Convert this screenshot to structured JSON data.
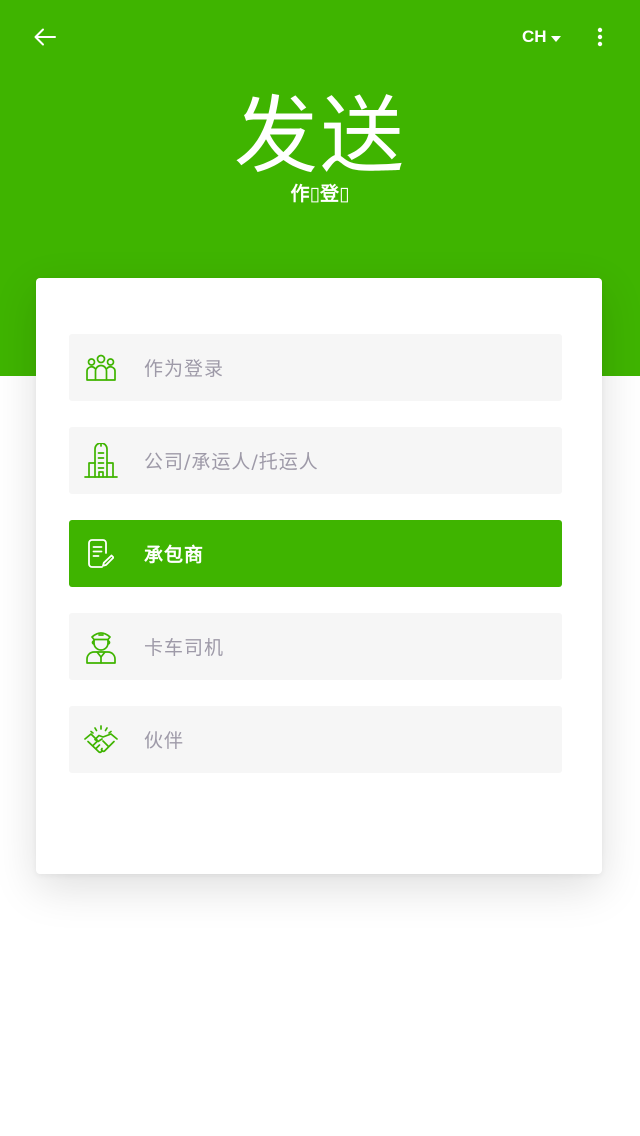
{
  "header": {
    "language": "CH",
    "title": "发送",
    "subtitle": "作▯登▯"
  },
  "colors": {
    "brand": "#3fb400",
    "option_bg": "#f6f6f6",
    "option_text": "#9e9aa8"
  },
  "icons": {
    "back": "arrow-left-icon",
    "language": "caret-down-icon",
    "more": "more-vertical-icon"
  },
  "roles": [
    {
      "label": "作为登录",
      "icon": "group-icon",
      "selected": false
    },
    {
      "label": "公司/承运人/托运人",
      "icon": "building-icon",
      "selected": false
    },
    {
      "label": "承包商",
      "icon": "contract-edit-icon",
      "selected": true
    },
    {
      "label": "卡车司机",
      "icon": "driver-icon",
      "selected": false
    },
    {
      "label": "伙伴",
      "icon": "handshake-icon",
      "selected": false
    }
  ]
}
